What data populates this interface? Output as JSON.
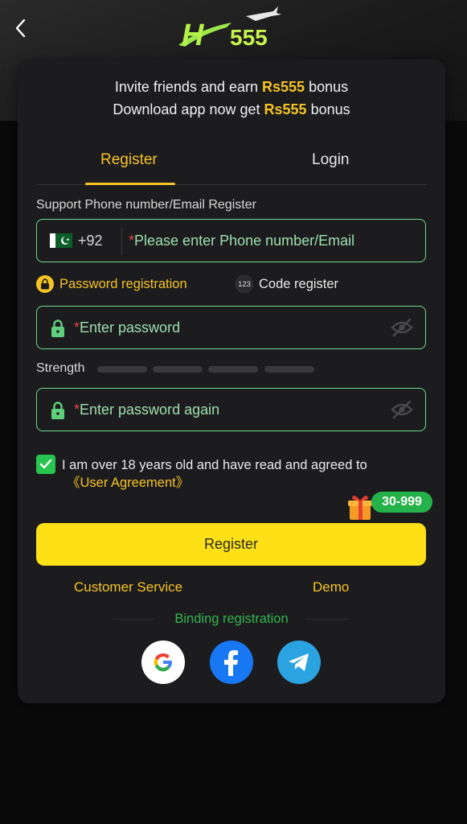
{
  "header": {
    "back_icon": "chevron-left-icon",
    "logo_text": "H555"
  },
  "promo": {
    "line1_prefix": "Invite friends and earn ",
    "line1_amount": "Rs555",
    "line1_suffix": " bonus",
    "line2_prefix": "Download app now get ",
    "line2_amount": "Rs555",
    "line2_suffix": " bonus"
  },
  "tabs": [
    {
      "label": "Register",
      "active": true
    },
    {
      "label": "Login",
      "active": false
    }
  ],
  "form": {
    "support_label": "Support Phone number/Email Register",
    "country_code": "+92",
    "phone_placeholder": "Please enter Phone number/Email",
    "required_mark": "*",
    "mode_password": "Password registration",
    "mode_code": "Code register",
    "code_icon_text": "123",
    "password_placeholder": "Enter password",
    "strength_label": "Strength",
    "strength_levels": 4,
    "confirm_placeholder": "Enter password again",
    "agree_text": "I am over 18 years old and have read and agreed to",
    "agree_link": "《User Agreement》",
    "agree_checked": true
  },
  "bonus_badge": "30-999",
  "register_button": "Register",
  "links": {
    "customer_service": "Customer Service",
    "demo": "Demo"
  },
  "binding": {
    "label": "Binding registration",
    "providers": [
      "google-icon",
      "facebook-icon",
      "telegram-icon"
    ]
  },
  "colors": {
    "accent_yellow": "#f6c323",
    "button_yellow": "#fde016",
    "field_border_green": "#6fd88f",
    "badge_green": "#26b24a",
    "background": "#0a0a0a",
    "card": "#1c1c1e"
  }
}
